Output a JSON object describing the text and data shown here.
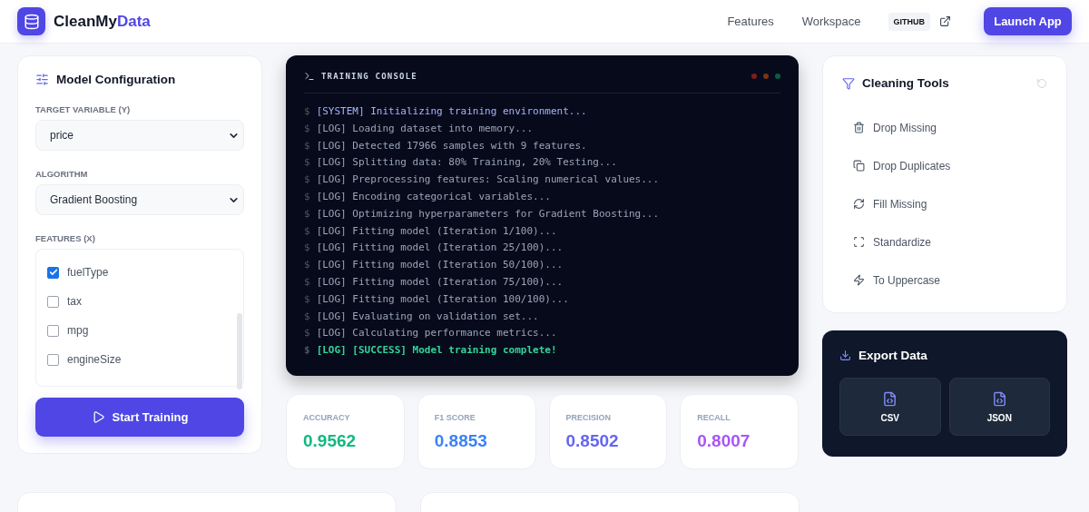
{
  "header": {
    "brand": "CleanMy",
    "brand_accent": "Data",
    "nav": [
      "Features",
      "Workspace"
    ],
    "github": "GITHUB",
    "launch": "Launch App"
  },
  "config": {
    "title": "Model Configuration",
    "target_label": "TARGET VARIABLE (Y)",
    "target_value": "price",
    "algorithm_label": "ALGORITHM",
    "algorithm_value": "Gradient Boosting",
    "features_label": "FEATURES (X)",
    "features": [
      {
        "name": "fuelType",
        "checked": true
      },
      {
        "name": "tax",
        "checked": false
      },
      {
        "name": "mpg",
        "checked": false
      },
      {
        "name": "engineSize",
        "checked": false
      }
    ],
    "start": "Start Training"
  },
  "console": {
    "title": "TRAINING CONSOLE",
    "lines": [
      {
        "prompt": "$",
        "text": "[SYSTEM] Initializing training environment...",
        "kind": "system"
      },
      {
        "prompt": "$",
        "text": "[LOG] Loading dataset into memory...",
        "kind": "log"
      },
      {
        "prompt": "$",
        "text": "[LOG] Detected 17966 samples with 9 features.",
        "kind": "log"
      },
      {
        "prompt": "$",
        "text": "[LOG] Splitting data: 80% Training, 20% Testing...",
        "kind": "log"
      },
      {
        "prompt": "$",
        "text": "[LOG] Preprocessing features: Scaling numerical values...",
        "kind": "log"
      },
      {
        "prompt": "$",
        "text": "[LOG] Encoding categorical variables...",
        "kind": "log"
      },
      {
        "prompt": "$",
        "text": "[LOG] Optimizing hyperparameters for Gradient Boosting...",
        "kind": "log"
      },
      {
        "prompt": "$",
        "text": "[LOG] Fitting model (Iteration 1/100)...",
        "kind": "log"
      },
      {
        "prompt": "$",
        "text": "[LOG] Fitting model (Iteration 25/100)...",
        "kind": "log"
      },
      {
        "prompt": "$",
        "text": "[LOG] Fitting model (Iteration 50/100)...",
        "kind": "log"
      },
      {
        "prompt": "$",
        "text": "[LOG] Fitting model (Iteration 75/100)...",
        "kind": "log"
      },
      {
        "prompt": "$",
        "text": "[LOG] Fitting model (Iteration 100/100)...",
        "kind": "log"
      },
      {
        "prompt": "$",
        "text": "[LOG] Evaluating on validation set...",
        "kind": "log"
      },
      {
        "prompt": "$",
        "text": "[LOG] Calculating performance metrics...",
        "kind": "log"
      },
      {
        "prompt": "$",
        "text": "[LOG] [SUCCESS] Model training complete!",
        "kind": "success"
      }
    ]
  },
  "metrics": [
    {
      "label": "ACCURACY",
      "value": "0.9562",
      "color": "#10b981"
    },
    {
      "label": "F1 SCORE",
      "value": "0.8853",
      "color": "#3b82f6"
    },
    {
      "label": "PRECISION",
      "value": "0.8502",
      "color": "#6366f1"
    },
    {
      "label": "RECALL",
      "value": "0.8007",
      "color": "#a855f7"
    }
  ],
  "cleaning": {
    "title": "Cleaning Tools",
    "tools": [
      {
        "label": "Drop Missing",
        "kind": "trash"
      },
      {
        "label": "Drop Duplicates",
        "kind": "copy"
      },
      {
        "label": "Fill Missing",
        "kind": "refresh"
      },
      {
        "label": "Standardize",
        "kind": "scan"
      },
      {
        "label": "To Uppercase",
        "kind": "zap"
      }
    ]
  },
  "export": {
    "title": "Export Data",
    "formats": [
      "CSV",
      "JSON"
    ]
  }
}
